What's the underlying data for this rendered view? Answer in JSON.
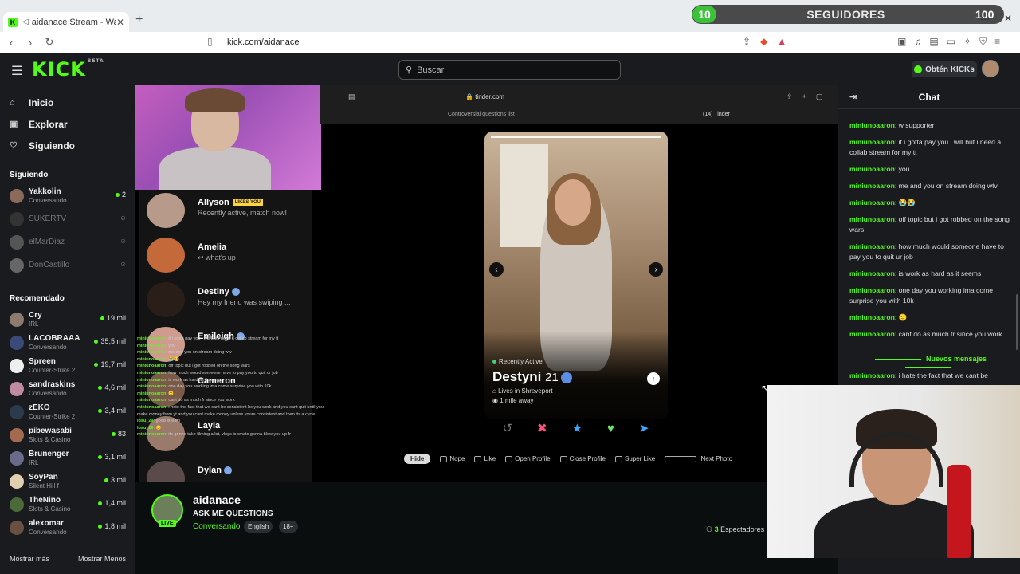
{
  "browser": {
    "tab_title": "aidanace Stream - Watch Live",
    "tab_sep": "◁",
    "url": "kick.com/aidanace"
  },
  "follow_overlay": {
    "left_count": "10",
    "label": "SEGUIDORES",
    "right_count": "100"
  },
  "header": {
    "logo": "KICK",
    "beta": "BETA",
    "search_placeholder": "Buscar",
    "kicks_label": "Obtén KICKs"
  },
  "sidebar": {
    "nav": [
      {
        "label": "Inicio",
        "icon": "home-icon"
      },
      {
        "label": "Explorar",
        "icon": "browse-icon"
      },
      {
        "label": "Siguiendo",
        "icon": "heart-icon"
      }
    ],
    "following_title": "Siguiendo",
    "following": [
      {
        "name": "Yakkolin",
        "sub": "Conversando",
        "count": "2",
        "live": true,
        "avatar_color": "#8a6a5a"
      },
      {
        "name": "SUKERTV",
        "sub": "",
        "count": "",
        "live": false,
        "avatar_color": "#333"
      },
      {
        "name": "elMarDiaz",
        "sub": "",
        "count": "",
        "live": false,
        "avatar_color": "#555"
      },
      {
        "name": "DonCastillo",
        "sub": "",
        "count": "",
        "live": false,
        "avatar_color": "#666"
      }
    ],
    "recommended_title": "Recomendado",
    "recommended": [
      {
        "name": "Cry",
        "sub": "IRL",
        "count": "19 mil",
        "avatar_color": "#8c7b6e"
      },
      {
        "name": "LACOBRAAA",
        "sub": "Conversando",
        "count": "35,5 mil",
        "avatar_color": "#3a4b7a"
      },
      {
        "name": "Spreen",
        "sub": "Counter-Strike 2",
        "count": "19,7 mil",
        "avatar_color": "#eeeeee"
      },
      {
        "name": "sandraskins",
        "sub": "Conversando",
        "count": "4,6 mil",
        "avatar_color": "#c08aa0"
      },
      {
        "name": "zEKO",
        "sub": "Counter-Strike 2",
        "count": "3,4 mil",
        "avatar_color": "#2b3b4b"
      },
      {
        "name": "pibewasabi",
        "sub": "Slots & Casino",
        "count": "83",
        "avatar_color": "#a36a50"
      },
      {
        "name": "Brunenger",
        "sub": "IRL",
        "count": "3,1 mil",
        "avatar_color": "#6a6a8a"
      },
      {
        "name": "SoyPan",
        "sub": "Silent Hill f",
        "count": "3 mil",
        "avatar_color": "#e0d0b0"
      },
      {
        "name": "TheNino",
        "sub": "Slots & Casino",
        "count": "1,4 mil",
        "avatar_color": "#4a6a3a"
      },
      {
        "name": "alexomar",
        "sub": "Conversando",
        "count": "1,8 mil",
        "avatar_color": "#6a5040"
      }
    ],
    "show_more": "Mostrar más",
    "show_less": "Mostrar Menos"
  },
  "stream": {
    "inner_url": "tinder.com",
    "inner_tab1": "Controversial questions list",
    "inner_tab2": "(14) Tinder",
    "matches": [
      {
        "name": "Allyson",
        "badge": "LIKES YOU",
        "msg": "Recently active, match now!",
        "verified": false
      },
      {
        "name": "Amelia",
        "badge": "",
        "msg": "↩ what's up",
        "verified": false
      },
      {
        "name": "Destiny",
        "badge": "",
        "msg": "Hey my friend was swiping ...",
        "verified": true
      },
      {
        "name": "Emileigh",
        "badge": "",
        "msg": "",
        "verified": true
      },
      {
        "name": "Cameron",
        "badge": "",
        "msg": "",
        "verified": false
      },
      {
        "name": "Layla",
        "badge": "",
        "msg": "",
        "verified": false
      },
      {
        "name": "Dylan",
        "badge": "",
        "msg": "",
        "verified": true
      }
    ],
    "overlay_chat": [
      {
        "u": "miniunoaaron",
        "t": ": if i gotta pay you i will but i need a collab stream for my tt"
      },
      {
        "u": "miniunoaaron",
        "t": ": you"
      },
      {
        "u": "miniunoaaron",
        "t": ": me and you on stream doing wtv"
      },
      {
        "u": "miniunoaaron",
        "t": ": 😭😭"
      },
      {
        "u": "miniunoaaron",
        "t": ": off topic but i got robbed on the song wars"
      },
      {
        "u": "miniunoaaron",
        "t": ": how much would someone have to pay you to quit ur job"
      },
      {
        "u": "miniunoaaron",
        "t": ": is work as hard as it seems"
      },
      {
        "u": "miniunoaaron",
        "t": ": one day you working ima come surprise you with 10k"
      },
      {
        "u": "miniunoaaron",
        "t": ": 🙂"
      },
      {
        "u": "miniunoaaron",
        "t": ": cant do as much fr since you work"
      },
      {
        "u": "miniunoaaron",
        "t": ": i hate the fact that we cant be consistent bc you work and you cant quit until you make money from yt and you cant make money unless youre consistent and then its a cycle"
      },
      {
        "u": "losu_29",
        "t": ": good stream"
      },
      {
        "u": "losu_29",
        "t": ": 😊"
      },
      {
        "u": "miniunoaaron",
        "t": ": its gonna take filming a lot, vlogs is whats gonna blow you up fr"
      }
    ],
    "profile": {
      "status": "Recently Active",
      "name": "Destyni",
      "age": "21",
      "location": "Lives in Shreveport",
      "distance": "1 mile away"
    },
    "hints": {
      "hide": "Hide",
      "nope": "Nope",
      "like": "Like",
      "open": "Open Profile",
      "close": "Close Profile",
      "super": "Super Like",
      "next": "Next Photo"
    }
  },
  "stream_info": {
    "name": "aidanace",
    "live_label": "LIVE",
    "title": "ASK ME QUESTIONS",
    "category": "Conversando",
    "tags": [
      "English",
      "18+"
    ],
    "viewers": "3",
    "viewers_label": "Espectadores"
  },
  "chat": {
    "title": "Chat",
    "messages": [
      {
        "u": "miniunoaaron",
        "t": ": w supporter"
      },
      {
        "u": "miniunoaaron",
        "t": ": if i gotta pay you i will but i need a collab stream for my tt"
      },
      {
        "u": "miniunoaaron",
        "t": ": you"
      },
      {
        "u": "miniunoaaron",
        "t": ": me and you on stream doing wtv"
      },
      {
        "u": "miniunoaaron",
        "t": ": 😭😭"
      },
      {
        "u": "miniunoaaron",
        "t": ": off topic but i got robbed on the song wars"
      },
      {
        "u": "miniunoaaron",
        "t": ": how much would someone have to pay you to quit ur job"
      },
      {
        "u": "miniunoaaron",
        "t": ": is work as hard as it seems"
      },
      {
        "u": "miniunoaaron",
        "t": ": one day you working ima come surprise you with 10k"
      },
      {
        "u": "miniunoaaron",
        "t": ": 🙂"
      },
      {
        "u": "miniunoaaron",
        "t": ": cant do as much fr since you work"
      }
    ],
    "new_messages_label": "Nuevos mensajes",
    "last_message": {
      "u": "miniunoaaron",
      "t": ": i hate the fact that we cant be"
    }
  },
  "colors": {
    "accent": "#53fc18",
    "bg": "#0b0e0f",
    "panel": "#191b1f"
  }
}
